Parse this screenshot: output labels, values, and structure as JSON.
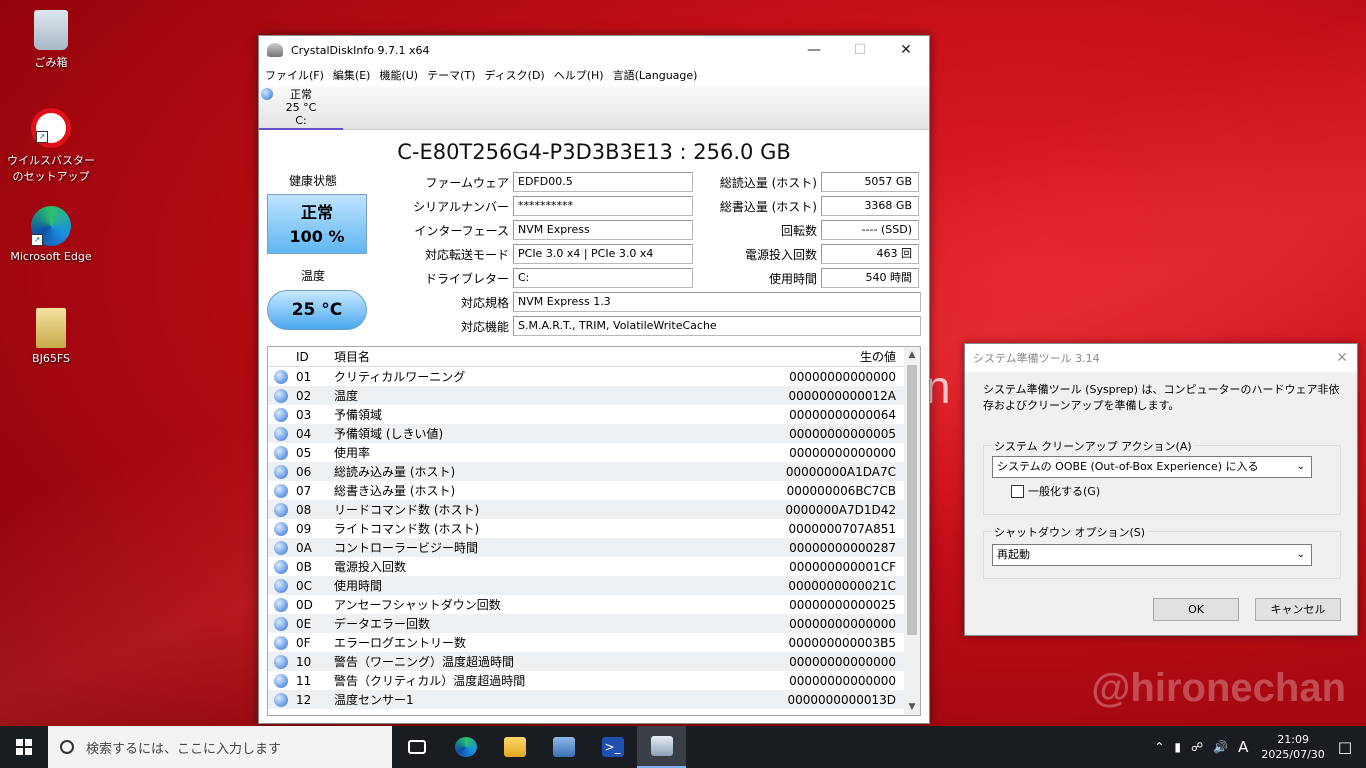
{
  "desktop": {
    "icons": [
      {
        "label": "ごみ箱",
        "icon": "recycle-bin-icon"
      },
      {
        "label": "ウイルスバスターのセットアップ",
        "icon": "trend-micro-icon"
      },
      {
        "label": "Microsoft Edge",
        "icon": "edge-icon"
      },
      {
        "label": "BJ65FS",
        "icon": "folder-file-icon"
      }
    ],
    "watermark": "@hironechan",
    "bg_text": "n"
  },
  "crystaldisk": {
    "title": "CrystalDiskInfo 9.7.1 x64",
    "menu": [
      "ファイル(F)",
      "編集(E)",
      "機能(U)",
      "テーマ(T)",
      "ディスク(D)",
      "ヘルプ(H)",
      "言語(Language)"
    ],
    "drive_tab": {
      "status": "正常",
      "temp": "25 °C",
      "letter": "C:"
    },
    "drive_title": "C-E80T256G4-P3D3B3E13 : 256.0 GB",
    "health_label": "健康状態",
    "health_status": "正常",
    "health_percent": "100 %",
    "temp_label": "温度",
    "temp_value": "25 °C",
    "fields_left": [
      {
        "label": "ファームウェア",
        "value": "EDFD00.5"
      },
      {
        "label": "シリアルナンバー",
        "value": "**********"
      },
      {
        "label": "インターフェース",
        "value": "NVM Express"
      },
      {
        "label": "対応転送モード",
        "value": "PCIe 3.0 x4 | PCIe 3.0 x4"
      },
      {
        "label": "ドライブレター",
        "value": "C:"
      },
      {
        "label": "対応規格",
        "value": "NVM Express 1.3"
      },
      {
        "label": "対応機能",
        "value": "S.M.A.R.T., TRIM, VolatileWriteCache"
      }
    ],
    "fields_right": [
      {
        "label": "総読込量 (ホスト)",
        "value": "5057 GB"
      },
      {
        "label": "総書込量 (ホスト)",
        "value": "3368 GB"
      },
      {
        "label": "回転数",
        "value": "---- (SSD)"
      },
      {
        "label": "電源投入回数",
        "value": "463 回"
      },
      {
        "label": "使用時間",
        "value": "540 時間"
      }
    ],
    "smart_headers": {
      "id": "ID",
      "name": "項目名",
      "raw": "生の値"
    },
    "smart_rows": [
      {
        "id": "01",
        "name": "クリティカルワーニング",
        "raw": "00000000000000"
      },
      {
        "id": "02",
        "name": "温度",
        "raw": "0000000000012A"
      },
      {
        "id": "03",
        "name": "予備領域",
        "raw": "00000000000064"
      },
      {
        "id": "04",
        "name": "予備領域 (しきい値)",
        "raw": "00000000000005"
      },
      {
        "id": "05",
        "name": "使用率",
        "raw": "00000000000000"
      },
      {
        "id": "06",
        "name": "総読み込み量 (ホスト)",
        "raw": "00000000A1DA7C"
      },
      {
        "id": "07",
        "name": "総書き込み量 (ホスト)",
        "raw": "000000006BC7CB"
      },
      {
        "id": "08",
        "name": "リードコマンド数 (ホスト)",
        "raw": "0000000A7D1D42"
      },
      {
        "id": "09",
        "name": "ライトコマンド数 (ホスト)",
        "raw": "0000000707A851"
      },
      {
        "id": "0A",
        "name": "コントローラービジー時間",
        "raw": "00000000000287"
      },
      {
        "id": "0B",
        "name": "電源投入回数",
        "raw": "000000000001CF"
      },
      {
        "id": "0C",
        "name": "使用時間",
        "raw": "0000000000021C"
      },
      {
        "id": "0D",
        "name": "アンセーフシャットダウン回数",
        "raw": "00000000000025"
      },
      {
        "id": "0E",
        "name": "データエラー回数",
        "raw": "00000000000000"
      },
      {
        "id": "0F",
        "name": "エラーログエントリー数",
        "raw": "000000000003B5"
      },
      {
        "id": "10",
        "name": "警告（ワーニング）温度超過時間",
        "raw": "00000000000000"
      },
      {
        "id": "11",
        "name": "警告（クリティカル）温度超過時間",
        "raw": "00000000000000"
      },
      {
        "id": "12",
        "name": "温度センサー1",
        "raw": "0000000000013D"
      }
    ]
  },
  "sysprep": {
    "title": "システム準備ツール 3.14",
    "description": "システム準備ツール (Sysprep) は、コンピューターのハードウェア非依存およびクリーンアップを準備します。",
    "cleanup_label": "システム クリーンアップ アクション(A)",
    "cleanup_value": "システムの OOBE (Out-of-Box Experience) に入る",
    "generalize_label": "一般化する(G)",
    "shutdown_label": "シャットダウン オプション(S)",
    "shutdown_value": "再起動",
    "ok": "OK",
    "cancel": "キャンセル"
  },
  "taskbar": {
    "search_placeholder": "検索するには、ここに入力します",
    "ime": "A",
    "time": "21:09",
    "date": "2025/07/30"
  }
}
